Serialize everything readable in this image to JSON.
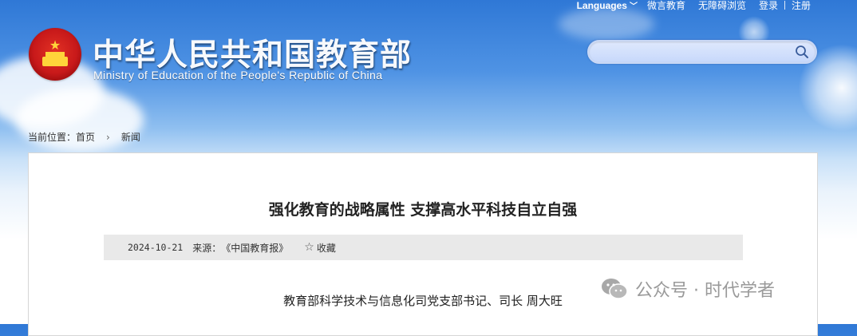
{
  "topbar": {
    "languages": "Languages",
    "weibo": "微言教育",
    "accessible": "无障碍浏览",
    "login": "登录",
    "register": "注册"
  },
  "header": {
    "title_cn": "中华人民共和国教育部",
    "title_en": "Ministry of Education of the People's Republic of China"
  },
  "search": {
    "placeholder": "",
    "value": ""
  },
  "breadcrumb": {
    "label": "当前位置：",
    "home": "首页",
    "current": "新闻"
  },
  "article": {
    "title": "强化教育的战略属性 支撑高水平科技自立自强",
    "date": "2024-10-21",
    "source_label": "来源：",
    "source": "《中国教育报》",
    "favorite": "收藏",
    "author_line": "教育部科学技术与信息化司党支部书记、司长 周大旺"
  },
  "watermark": {
    "text": "公众号 · 时代学者"
  },
  "colors": {
    "sky_top": "#2f78d6",
    "title_text": "#222222",
    "meta_bg": "#e9e9e9",
    "watermark": "#9a9a9a"
  }
}
